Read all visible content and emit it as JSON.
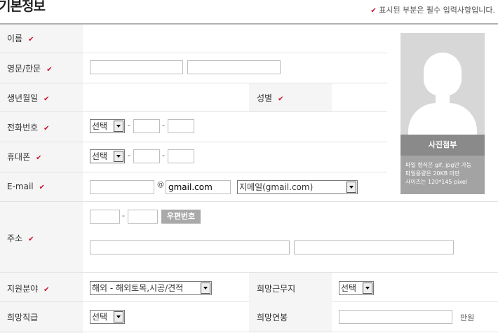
{
  "page_title": "기본정보",
  "required_note": "표시된 부분은 필수 입력사항입니다.",
  "check_mark": "✔",
  "fields": {
    "name_label": "이름",
    "eng_name_label": "영문/한문",
    "birth_label": "생년월일",
    "gender_label": "성별",
    "phone_label": "전화번호",
    "mobile_label": "휴대폰",
    "email_label": "E-mail",
    "address_label": "주소",
    "field_label": "지원분야",
    "location_label": "희망근무지",
    "position_label": "희망직급",
    "salary_label": "희망연봉"
  },
  "selects": {
    "phone_prefix": "선택",
    "mobile_prefix": "선택",
    "email_domain": "지메일(gmail.com)",
    "apply_field": "해외 - 해외토목,시공/견적",
    "work_location": "선택",
    "position": "선택"
  },
  "inputs": {
    "email_domain_text": "gmail.com"
  },
  "separators": {
    "dash": "-",
    "at": "@"
  },
  "buttons": {
    "zipcode": "우편번호",
    "photo_attach": "사진첨부"
  },
  "photo_info": [
    "파일 형식은 gif, jpg만 가능",
    "파일용량은 20KB 미만",
    "사이즈는 120*145 pixel"
  ],
  "salary_unit": "만원"
}
